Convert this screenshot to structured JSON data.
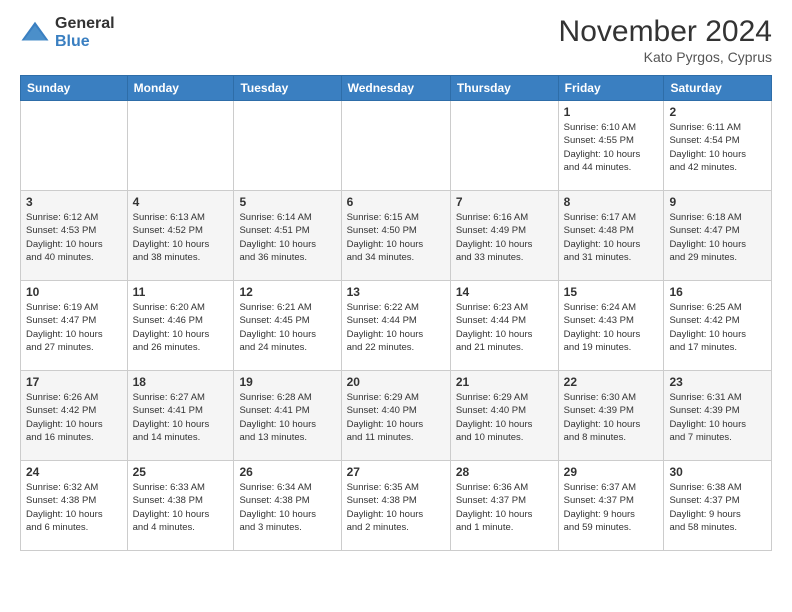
{
  "header": {
    "logo_general": "General",
    "logo_blue": "Blue",
    "month_title": "November 2024",
    "location": "Kato Pyrgos, Cyprus"
  },
  "weekdays": [
    "Sunday",
    "Monday",
    "Tuesday",
    "Wednesday",
    "Thursday",
    "Friday",
    "Saturday"
  ],
  "weeks": [
    [
      {
        "day": "",
        "info": ""
      },
      {
        "day": "",
        "info": ""
      },
      {
        "day": "",
        "info": ""
      },
      {
        "day": "",
        "info": ""
      },
      {
        "day": "",
        "info": ""
      },
      {
        "day": "1",
        "info": "Sunrise: 6:10 AM\nSunset: 4:55 PM\nDaylight: 10 hours\nand 44 minutes."
      },
      {
        "day": "2",
        "info": "Sunrise: 6:11 AM\nSunset: 4:54 PM\nDaylight: 10 hours\nand 42 minutes."
      }
    ],
    [
      {
        "day": "3",
        "info": "Sunrise: 6:12 AM\nSunset: 4:53 PM\nDaylight: 10 hours\nand 40 minutes."
      },
      {
        "day": "4",
        "info": "Sunrise: 6:13 AM\nSunset: 4:52 PM\nDaylight: 10 hours\nand 38 minutes."
      },
      {
        "day": "5",
        "info": "Sunrise: 6:14 AM\nSunset: 4:51 PM\nDaylight: 10 hours\nand 36 minutes."
      },
      {
        "day": "6",
        "info": "Sunrise: 6:15 AM\nSunset: 4:50 PM\nDaylight: 10 hours\nand 34 minutes."
      },
      {
        "day": "7",
        "info": "Sunrise: 6:16 AM\nSunset: 4:49 PM\nDaylight: 10 hours\nand 33 minutes."
      },
      {
        "day": "8",
        "info": "Sunrise: 6:17 AM\nSunset: 4:48 PM\nDaylight: 10 hours\nand 31 minutes."
      },
      {
        "day": "9",
        "info": "Sunrise: 6:18 AM\nSunset: 4:47 PM\nDaylight: 10 hours\nand 29 minutes."
      }
    ],
    [
      {
        "day": "10",
        "info": "Sunrise: 6:19 AM\nSunset: 4:47 PM\nDaylight: 10 hours\nand 27 minutes."
      },
      {
        "day": "11",
        "info": "Sunrise: 6:20 AM\nSunset: 4:46 PM\nDaylight: 10 hours\nand 26 minutes."
      },
      {
        "day": "12",
        "info": "Sunrise: 6:21 AM\nSunset: 4:45 PM\nDaylight: 10 hours\nand 24 minutes."
      },
      {
        "day": "13",
        "info": "Sunrise: 6:22 AM\nSunset: 4:44 PM\nDaylight: 10 hours\nand 22 minutes."
      },
      {
        "day": "14",
        "info": "Sunrise: 6:23 AM\nSunset: 4:44 PM\nDaylight: 10 hours\nand 21 minutes."
      },
      {
        "day": "15",
        "info": "Sunrise: 6:24 AM\nSunset: 4:43 PM\nDaylight: 10 hours\nand 19 minutes."
      },
      {
        "day": "16",
        "info": "Sunrise: 6:25 AM\nSunset: 4:42 PM\nDaylight: 10 hours\nand 17 minutes."
      }
    ],
    [
      {
        "day": "17",
        "info": "Sunrise: 6:26 AM\nSunset: 4:42 PM\nDaylight: 10 hours\nand 16 minutes."
      },
      {
        "day": "18",
        "info": "Sunrise: 6:27 AM\nSunset: 4:41 PM\nDaylight: 10 hours\nand 14 minutes."
      },
      {
        "day": "19",
        "info": "Sunrise: 6:28 AM\nSunset: 4:41 PM\nDaylight: 10 hours\nand 13 minutes."
      },
      {
        "day": "20",
        "info": "Sunrise: 6:29 AM\nSunset: 4:40 PM\nDaylight: 10 hours\nand 11 minutes."
      },
      {
        "day": "21",
        "info": "Sunrise: 6:29 AM\nSunset: 4:40 PM\nDaylight: 10 hours\nand 10 minutes."
      },
      {
        "day": "22",
        "info": "Sunrise: 6:30 AM\nSunset: 4:39 PM\nDaylight: 10 hours\nand 8 minutes."
      },
      {
        "day": "23",
        "info": "Sunrise: 6:31 AM\nSunset: 4:39 PM\nDaylight: 10 hours\nand 7 minutes."
      }
    ],
    [
      {
        "day": "24",
        "info": "Sunrise: 6:32 AM\nSunset: 4:38 PM\nDaylight: 10 hours\nand 6 minutes."
      },
      {
        "day": "25",
        "info": "Sunrise: 6:33 AM\nSunset: 4:38 PM\nDaylight: 10 hours\nand 4 minutes."
      },
      {
        "day": "26",
        "info": "Sunrise: 6:34 AM\nSunset: 4:38 PM\nDaylight: 10 hours\nand 3 minutes."
      },
      {
        "day": "27",
        "info": "Sunrise: 6:35 AM\nSunset: 4:38 PM\nDaylight: 10 hours\nand 2 minutes."
      },
      {
        "day": "28",
        "info": "Sunrise: 6:36 AM\nSunset: 4:37 PM\nDaylight: 10 hours\nand 1 minute."
      },
      {
        "day": "29",
        "info": "Sunrise: 6:37 AM\nSunset: 4:37 PM\nDaylight: 9 hours\nand 59 minutes."
      },
      {
        "day": "30",
        "info": "Sunrise: 6:38 AM\nSunset: 4:37 PM\nDaylight: 9 hours\nand 58 minutes."
      }
    ]
  ]
}
